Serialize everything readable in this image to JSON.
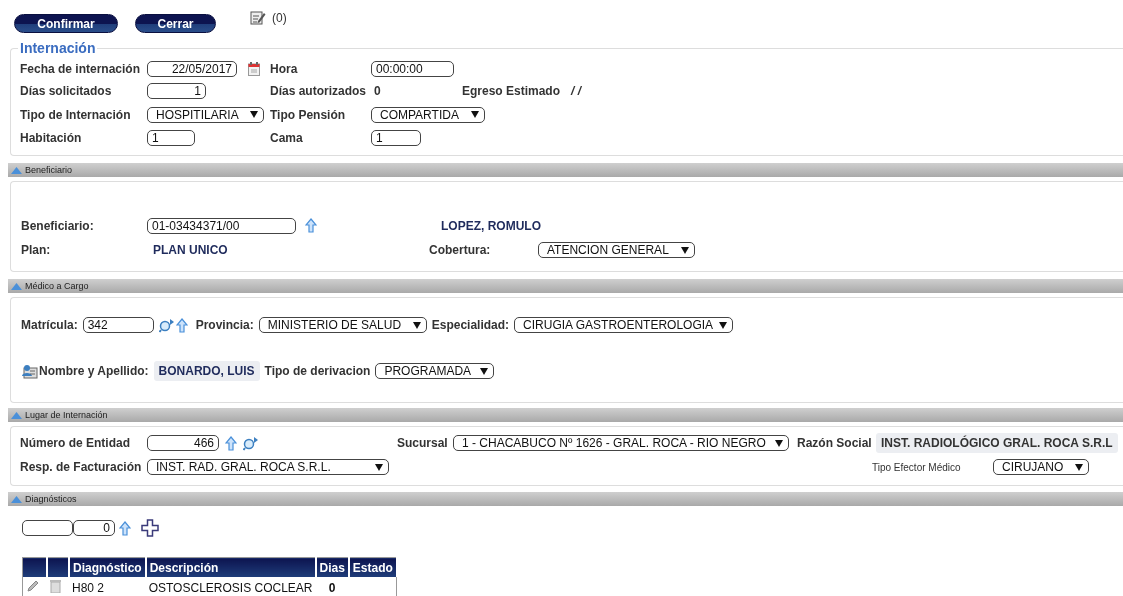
{
  "toolbar": {
    "buttons": [
      "Confirmar",
      "Cerrar"
    ],
    "notes_count": "(0)"
  },
  "internacion": {
    "legend": "Internación",
    "fecha": {
      "label": "Fecha de internación",
      "value": "22/05/2017"
    },
    "hora": {
      "label": "Hora",
      "value": "00:00:00"
    },
    "dias_solicitados": {
      "label": "Días solicitados",
      "value": "1"
    },
    "dias_autorizados": {
      "label": "Días autorizados",
      "value": "0"
    },
    "egreso": {
      "label": "Egreso Estimado",
      "value": "/ /"
    },
    "tipo_internacion": {
      "label": "Tipo de Internación",
      "value": "HOSPITILARIA"
    },
    "tipo_pension": {
      "label": "Tipo Pensión",
      "value": "COMPARTIDA"
    },
    "habitacion": {
      "label": "Habitación",
      "value": "1"
    },
    "cama": {
      "label": "Cama",
      "value": "1"
    }
  },
  "beneficiario": {
    "title": "Beneficiario",
    "expanded": true,
    "beneficiario": {
      "label": "Beneficiario:",
      "value": "01-03434371/00"
    },
    "nombre": "LOPEZ, ROMULO",
    "plan": {
      "label": "Plan:",
      "value": "PLAN UNICO"
    },
    "cobertura": {
      "label": "Cobertura:",
      "value": "ATENCION GENERAL"
    }
  },
  "medico": {
    "title": "Médico a Cargo",
    "expanded": true,
    "matricula": {
      "label": "Matrícula:",
      "value": "342"
    },
    "provincia": {
      "label": "Provincia:",
      "value": "MINISTERIO DE SALUD"
    },
    "especialidad": {
      "label": "Especialidad:",
      "value": "CIRUGIA GASTROENTEROLOGIA"
    },
    "nombre": {
      "label": "Nombre y Apellido:",
      "value": "BONARDO, LUIS"
    },
    "derivacion": {
      "label": "Tipo de derivacion",
      "value": "PROGRAMADA"
    }
  },
  "lugar": {
    "title": "Lugar de Internación",
    "expanded": true,
    "entidad": {
      "label": "Número de Entidad",
      "value": "466"
    },
    "sucursal": {
      "label": "Sucursal",
      "value": "1 - CHACABUCO Nº 1626 - GRAL. ROCA - RIO NEGRO"
    },
    "razon": {
      "label": "Razón Social",
      "value": "INST. RADIOLÓGICO GRAL. ROCA S.R.L"
    },
    "facturacion": {
      "label": "Resp. de Facturación",
      "value": "INST. RAD. GRAL. ROCA S.R.L."
    },
    "efector": {
      "label": "Tipo Efector Médico",
      "value": "CIRUJANO"
    }
  },
  "diagnosticos": {
    "title": "Diagnósticos",
    "expanded": true,
    "dias_value": "0",
    "columns": [
      "Diagnóstico",
      "Descripción",
      "Dias",
      "Estado"
    ],
    "rows": [
      {
        "code": "H80 2",
        "description": "OSTOSCLEROSIS COCLEAR",
        "days": "0"
      }
    ]
  }
}
